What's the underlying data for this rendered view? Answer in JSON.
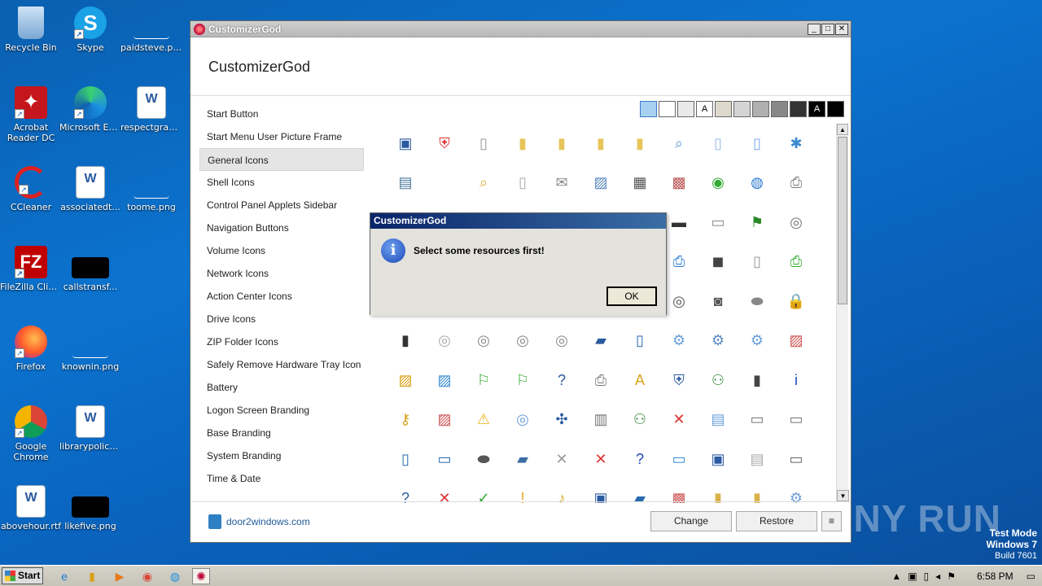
{
  "desktop": {
    "icons": [
      {
        "label": "Recycle Bin"
      },
      {
        "label": "Skype"
      },
      {
        "label": "paidsteve.png"
      },
      {
        "label": "Acrobat Reader DC"
      },
      {
        "label": "Microsoft Edge"
      },
      {
        "label": "respectgrad..."
      },
      {
        "label": "CCleaner"
      },
      {
        "label": "associatedt..."
      },
      {
        "label": "toome.png"
      },
      {
        "label": "FileZilla Client"
      },
      {
        "label": "callstransf..."
      },
      {
        "label": "Firefox"
      },
      {
        "label": "knownin.png"
      },
      {
        "label": "Google Chrome"
      },
      {
        "label": "librarypolicy..."
      },
      {
        "label": "abovehour.rtf"
      },
      {
        "label": "likefive.png"
      }
    ],
    "watermark": "ANY RUN",
    "test_mode": {
      "line1": "Test Mode",
      "line2": "Windows 7",
      "line3": "Build 7601"
    }
  },
  "window": {
    "title": "CustomizerGod",
    "header": "CustomizerGod",
    "title_buttons": {
      "minimize": "_",
      "maximize": "□",
      "close": "✕"
    },
    "sidebar": [
      {
        "label": "Start Button"
      },
      {
        "label": "Start Menu User Picture Frame"
      },
      {
        "label": "General Icons",
        "selected": true
      },
      {
        "label": "Shell Icons"
      },
      {
        "label": "Control Panel Applets Sidebar"
      },
      {
        "label": "Navigation Buttons"
      },
      {
        "label": "Volume Icons"
      },
      {
        "label": "Network Icons"
      },
      {
        "label": "Action Center Icons"
      },
      {
        "label": "Drive Icons"
      },
      {
        "label": "ZIP Folder Icons"
      },
      {
        "label": "Safely Remove Hardware Tray Icon"
      },
      {
        "label": "Battery"
      },
      {
        "label": "Logon Screen Branding"
      },
      {
        "label": "Base Branding"
      },
      {
        "label": "System Branding"
      },
      {
        "label": "Time & Date"
      }
    ],
    "swatches": [
      {
        "color": "#a8d0f0",
        "label": ""
      },
      {
        "color": "#ffffff",
        "label": ""
      },
      {
        "color": "#e9e9e9",
        "label": ""
      },
      {
        "color": "#ffffff",
        "label": "A"
      },
      {
        "color": "#ddd8cc",
        "label": ""
      },
      {
        "color": "#d4d4d4",
        "label": ""
      },
      {
        "color": "#b0b0b0",
        "label": ""
      },
      {
        "color": "#888888",
        "label": ""
      },
      {
        "color": "#333333",
        "label": ""
      },
      {
        "color": "#000000",
        "label": "A"
      },
      {
        "color": "#000000",
        "label": ""
      }
    ],
    "footer": {
      "link": "door2windows.com",
      "change": "Change",
      "restore": "Restore",
      "menu": "≡"
    }
  },
  "icons_grid": [
    {
      "name": "monitor-icon",
      "g": "▣",
      "c": "#2a5aa0"
    },
    {
      "name": "shield-icon",
      "g": "⛨",
      "c": "#d33"
    },
    {
      "name": "file-icon",
      "g": "▯",
      "c": "#999"
    },
    {
      "name": "folder-icon",
      "g": "▮",
      "c": "#e6c55a"
    },
    {
      "name": "folder-icon",
      "g": "▮",
      "c": "#e6c55a"
    },
    {
      "name": "folder-icon",
      "g": "▮",
      "c": "#e6c55a"
    },
    {
      "name": "folder-icon",
      "g": "▮",
      "c": "#e6c55a"
    },
    {
      "name": "search-icon",
      "g": "⌕",
      "c": "#6a9fd8"
    },
    {
      "name": "document-icon",
      "g": "▯",
      "c": "#9ab8e8"
    },
    {
      "name": "document-icon",
      "g": "▯",
      "c": "#7aa8e8"
    },
    {
      "name": "puzzle-icon",
      "g": "✱",
      "c": "#3a8ad0"
    },
    {
      "name": "window-icon",
      "g": "▤",
      "c": "#4a7a9a"
    },
    {
      "name": "blank",
      "g": "",
      "c": "#fff"
    },
    {
      "name": "folder-search-icon",
      "g": "⌕",
      "c": "#d9b24a"
    },
    {
      "name": "file-icon",
      "g": "▯",
      "c": "#aaa"
    },
    {
      "name": "mail-icon",
      "g": "✉",
      "c": "#888"
    },
    {
      "name": "image-icon",
      "g": "▨",
      "c": "#5a8ac0"
    },
    {
      "name": "calculator-icon",
      "g": "▦",
      "c": "#555"
    },
    {
      "name": "video-icon",
      "g": "▩",
      "c": "#b55"
    },
    {
      "name": "windows-media-icon",
      "g": "◉",
      "c": "#3a3"
    },
    {
      "name": "globe-icon",
      "g": "◍",
      "c": "#2a7ad0"
    },
    {
      "name": "printer-icon",
      "g": "⎙",
      "c": "#777"
    },
    {
      "name": "hidden",
      "g": "",
      "c": "#fff"
    },
    {
      "name": "hidden",
      "g": "",
      "c": "#fff"
    },
    {
      "name": "hidden",
      "g": "",
      "c": "#fff"
    },
    {
      "name": "hidden",
      "g": "",
      "c": "#fff"
    },
    {
      "name": "hidden",
      "g": "",
      "c": "#fff"
    },
    {
      "name": "hidden",
      "g": "",
      "c": "#fff"
    },
    {
      "name": "hidden",
      "g": "",
      "c": "#fff"
    },
    {
      "name": "chip-icon",
      "g": "▬",
      "c": "#333"
    },
    {
      "name": "drive-icon",
      "g": "▭",
      "c": "#888"
    },
    {
      "name": "windows-flag-icon",
      "g": "⚑",
      "c": "#2a8a2a"
    },
    {
      "name": "dvd-drive-icon",
      "g": "◎",
      "c": "#777"
    },
    {
      "name": "hidden",
      "g": "",
      "c": "#fff"
    },
    {
      "name": "hidden",
      "g": "",
      "c": "#fff"
    },
    {
      "name": "hidden",
      "g": "",
      "c": "#fff"
    },
    {
      "name": "hidden",
      "g": "",
      "c": "#fff"
    },
    {
      "name": "hidden",
      "g": "",
      "c": "#fff"
    },
    {
      "name": "hidden",
      "g": "",
      "c": "#fff"
    },
    {
      "name": "hidden",
      "g": "",
      "c": "#fff"
    },
    {
      "name": "network-printer-icon",
      "g": "⎙",
      "c": "#2a7ad0"
    },
    {
      "name": "camcorder-icon",
      "g": "◼",
      "c": "#444"
    },
    {
      "name": "phone-icon",
      "g": "▯",
      "c": "#999"
    },
    {
      "name": "printer-check-icon",
      "g": "⎙",
      "c": "#3a3"
    },
    {
      "name": "hidden",
      "g": "",
      "c": "#fff"
    },
    {
      "name": "hidden",
      "g": "",
      "c": "#fff"
    },
    {
      "name": "hidden",
      "g": "",
      "c": "#fff"
    },
    {
      "name": "hidden",
      "g": "",
      "c": "#fff"
    },
    {
      "name": "hidden",
      "g": "",
      "c": "#fff"
    },
    {
      "name": "hidden",
      "g": "",
      "c": "#fff"
    },
    {
      "name": "hidden",
      "g": "",
      "c": "#fff"
    },
    {
      "name": "dvd-icon",
      "g": "◎",
      "c": "#555"
    },
    {
      "name": "camera-icon",
      "g": "◙",
      "c": "#555"
    },
    {
      "name": "scanner-icon",
      "g": "⬬",
      "c": "#888"
    },
    {
      "name": "lock-icon",
      "g": "🔒",
      "c": "#d9a21a"
    },
    {
      "name": "media-player-icon",
      "g": "▮",
      "c": "#333"
    },
    {
      "name": "cd-icon",
      "g": "◎",
      "c": "#aaa"
    },
    {
      "name": "cd-r-icon",
      "g": "◎",
      "c": "#888"
    },
    {
      "name": "cd-rom-icon",
      "g": "◎",
      "c": "#888"
    },
    {
      "name": "cd-rw-icon",
      "g": "◎",
      "c": "#888"
    },
    {
      "name": "book-icon",
      "g": "▰",
      "c": "#2a5aa0"
    },
    {
      "name": "mobile-icon",
      "g": "▯",
      "c": "#2a6ab0"
    },
    {
      "name": "settings-doc-icon",
      "g": "⚙",
      "c": "#6a9fd8"
    },
    {
      "name": "settings-icon",
      "g": "⚙",
      "c": "#5a8ac0"
    },
    {
      "name": "gear-file-icon",
      "g": "⚙",
      "c": "#6a9fd8"
    },
    {
      "name": "photo-icon",
      "g": "▨",
      "c": "#c55"
    },
    {
      "name": "picture-icon",
      "g": "▨",
      "c": "#d9a21a"
    },
    {
      "name": "landscape-icon",
      "g": "▨",
      "c": "#3a8ad0"
    },
    {
      "name": "network-share-icon",
      "g": "⚐",
      "c": "#3a3"
    },
    {
      "name": "network-folder-icon",
      "g": "⚐",
      "c": "#3a3"
    },
    {
      "name": "help-drive-icon",
      "g": "?",
      "c": "#2a5aa0"
    },
    {
      "name": "fax-icon",
      "g": "⎙",
      "c": "#777"
    },
    {
      "name": "font-folder-icon",
      "g": "A",
      "c": "#d9a21a"
    },
    {
      "name": "uac-shield-icon",
      "g": "⛨",
      "c": "#2a5aa0"
    },
    {
      "name": "users-icon",
      "g": "⚇",
      "c": "#3a8a3a"
    },
    {
      "name": "server-icon",
      "g": "▮",
      "c": "#444"
    },
    {
      "name": "info-icon",
      "g": "i",
      "c": "#1d47b8"
    },
    {
      "name": "key-icon",
      "g": "⚷",
      "c": "#d9a21a"
    },
    {
      "name": "gallery-icon",
      "g": "▨",
      "c": "#c55"
    },
    {
      "name": "warning-icon",
      "g": "⚠",
      "c": "#e8b41a"
    },
    {
      "name": "disc-icon",
      "g": "◎",
      "c": "#6a9fd8"
    },
    {
      "name": "navigation-icon",
      "g": "✣",
      "c": "#2a5aa0"
    },
    {
      "name": "program-icon",
      "g": "▥",
      "c": "#777"
    },
    {
      "name": "user-accounts-icon",
      "g": "⚇",
      "c": "#3a8a3a"
    },
    {
      "name": "red-x-icon",
      "g": "✕",
      "c": "#d33"
    },
    {
      "name": "text-file-icon",
      "g": "▤",
      "c": "#6a9fd8"
    },
    {
      "name": "drive-fixed-icon",
      "g": "▭",
      "c": "#777"
    },
    {
      "name": "window-frame-icon",
      "g": "▭",
      "c": "#777"
    },
    {
      "name": "pda-icon",
      "g": "▯",
      "c": "#2a6ab0"
    },
    {
      "name": "network-adapter-icon",
      "g": "▭",
      "c": "#2a6ab0"
    },
    {
      "name": "scanner-flat-icon",
      "g": "⬬",
      "c": "#555"
    },
    {
      "name": "window-blue-icon",
      "g": "▰",
      "c": "#3a6ea5"
    },
    {
      "name": "close-small-icon",
      "g": "✕",
      "c": "#999"
    },
    {
      "name": "error-icon",
      "g": "✕",
      "c": "#d33"
    },
    {
      "name": "help-icon",
      "g": "?",
      "c": "#1d47b8"
    },
    {
      "name": "card-icon",
      "g": "▭",
      "c": "#3a8ad0"
    },
    {
      "name": "display-icon",
      "g": "▣",
      "c": "#2a5aa0"
    },
    {
      "name": "notepad-icon",
      "g": "▤",
      "c": "#aaa"
    },
    {
      "name": "presentation-icon",
      "g": "▭",
      "c": "#666"
    },
    {
      "name": "help-shield-icon",
      "g": "?",
      "c": "#2a5aa0"
    },
    {
      "name": "error-shield-icon",
      "g": "✕",
      "c": "#d33"
    },
    {
      "name": "ok-shield-icon",
      "g": "✓",
      "c": "#3a3"
    },
    {
      "name": "warning-shield-icon",
      "g": "!",
      "c": "#e8a41a"
    },
    {
      "name": "music-folder-icon",
      "g": "♪",
      "c": "#d9a21a"
    },
    {
      "name": "computer-icon",
      "g": "▣",
      "c": "#2a5aa0"
    },
    {
      "name": "screen-icon",
      "g": "▰",
      "c": "#2a6ab0"
    },
    {
      "name": "video-folder-icon",
      "g": "▩",
      "c": "#c55"
    },
    {
      "name": "folder-doc-icon",
      "g": "▮",
      "c": "#d9b24a"
    },
    {
      "name": "folder-image-icon",
      "g": "▮",
      "c": "#d9b24a"
    },
    {
      "name": "settings-check-icon",
      "g": "⚙",
      "c": "#6a9fd8"
    }
  ],
  "dialog": {
    "title": "CustomizerGod",
    "message": "Select some resources first!",
    "ok": "OK",
    "icon": "i"
  },
  "taskbar": {
    "start": "Start",
    "clock": "6:58 PM"
  }
}
